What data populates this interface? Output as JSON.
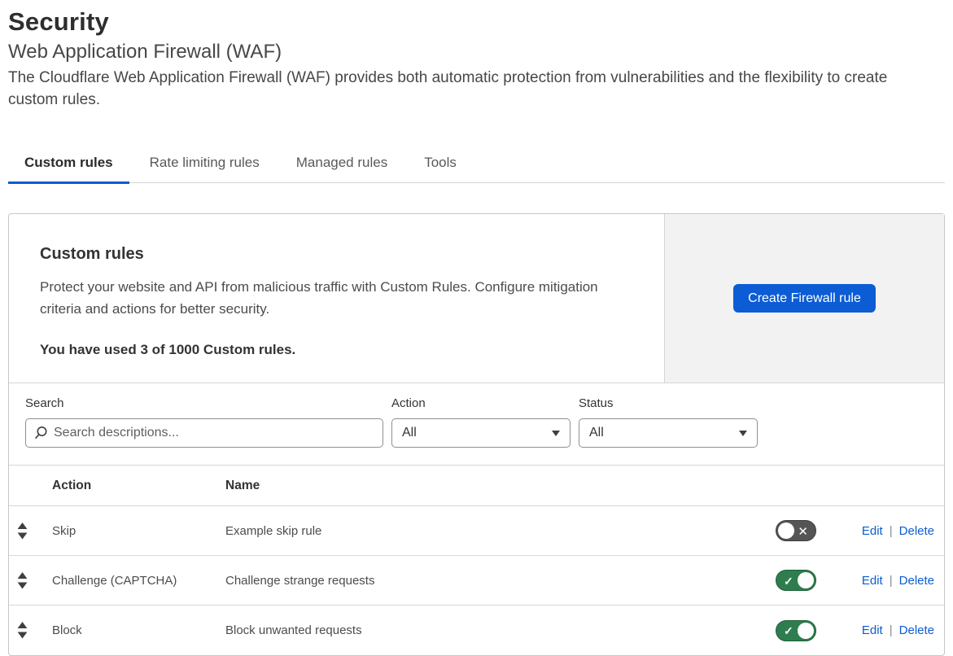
{
  "page": {
    "title": "Security",
    "subtitle": "Web Application Firewall (WAF)",
    "description": "The Cloudflare Web Application Firewall (WAF) provides both automatic protection from vulnerabilities and the flexibility to create custom rules."
  },
  "tabs": [
    {
      "label": "Custom rules",
      "active": true
    },
    {
      "label": "Rate limiting rules",
      "active": false
    },
    {
      "label": "Managed rules",
      "active": false
    },
    {
      "label": "Tools",
      "active": false
    }
  ],
  "panel": {
    "heading": "Custom rules",
    "description": "Protect your website and API from malicious traffic with Custom Rules. Configure mitigation criteria and actions for better security.",
    "usage_note": "You have used 3 of 1000 Custom rules.",
    "create_button_label": "Create Firewall rule"
  },
  "filters": {
    "search_label": "Search",
    "search_placeholder": "Search descriptions...",
    "action_label": "Action",
    "action_value": "All",
    "status_label": "Status",
    "status_value": "All"
  },
  "table": {
    "columns": [
      "Action",
      "Name"
    ],
    "edit_label": "Edit",
    "delete_label": "Delete",
    "separator": "|",
    "rows": [
      {
        "action": "Skip",
        "name": "Example skip rule",
        "enabled": false
      },
      {
        "action": "Challenge (CAPTCHA)",
        "name": "Challenge strange requests",
        "enabled": true
      },
      {
        "action": "Block",
        "name": "Block unwanted requests",
        "enabled": true
      }
    ]
  },
  "icons": {
    "search": "search-icon",
    "drag": "drag-reorder-icon",
    "toggle_on": "check-icon",
    "toggle_off": "x-icon",
    "select_caret": "chevron-down-icon"
  },
  "colors": {
    "accent_blue": "#0b5cd5",
    "link_blue": "#0b5cd5",
    "toggle_on_green": "#2e7d4e",
    "toggle_off_gray": "#555555",
    "panel_header_gray": "#f2f2f2",
    "border_gray": "#c6c6c6"
  }
}
